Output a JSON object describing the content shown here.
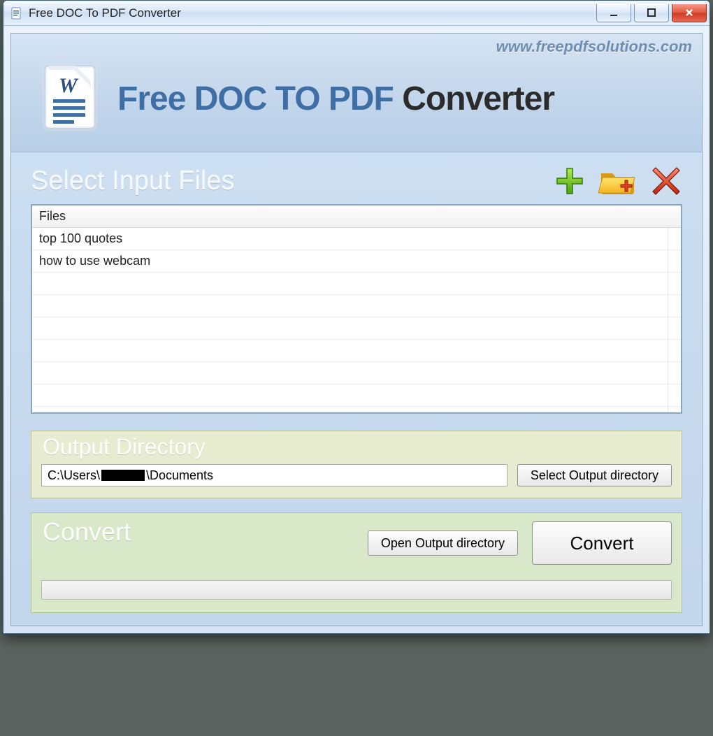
{
  "window": {
    "title": "Free DOC To PDF Converter"
  },
  "header": {
    "website": "www.freepdfsolutions.com",
    "brand": {
      "w1": "Free",
      "w2": "DOC",
      "w3": "TO PDF",
      "w4": "Converter"
    }
  },
  "input_section": {
    "title": "Select Input Files",
    "column_header": "Files",
    "files": [
      "top 100 quotes",
      "how to use webcam"
    ]
  },
  "output_section": {
    "title": "Output Directory",
    "path_prefix": "C:\\Users\\",
    "path_suffix": "\\Documents",
    "select_btn": "Select Output directory"
  },
  "convert_section": {
    "title": "Convert",
    "open_btn": "Open Output directory",
    "convert_btn": "Convert",
    "progress_value": 0
  },
  "icons": {
    "add": "plus-icon",
    "folder": "folder-add-icon",
    "remove": "remove-x-icon"
  }
}
